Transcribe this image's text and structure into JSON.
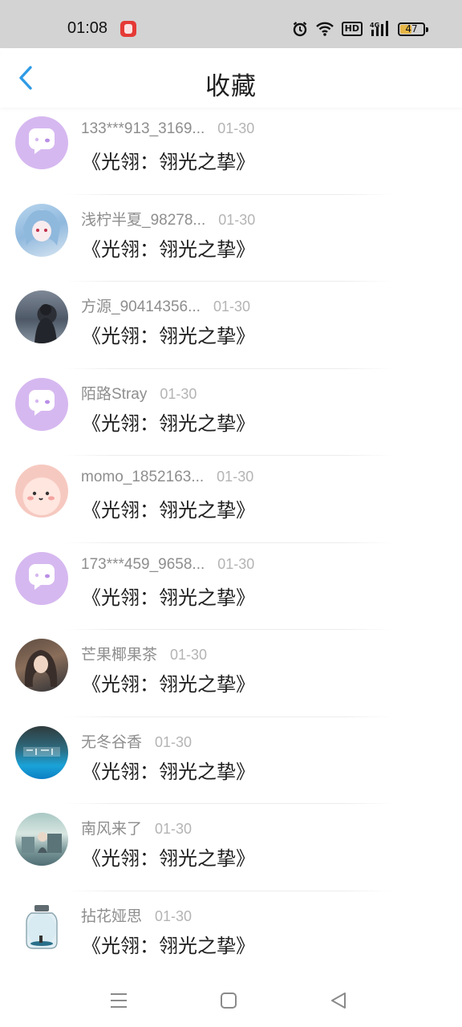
{
  "status_bar": {
    "time": "01:08",
    "battery": "47",
    "network": "4G",
    "hd": "HD",
    "icons": [
      "app-icon",
      "alarm-icon",
      "wifi-icon",
      "hd-icon",
      "signal-icon",
      "battery-icon"
    ]
  },
  "header": {
    "title": "收藏",
    "back_icon": "chevron-left-icon"
  },
  "colors": {
    "accent": "#2f9be6",
    "default_avatar": "#d6b8f0",
    "username_gray": "#8e8e8e",
    "date_gray": "#b4b4b4"
  },
  "favorites": [
    {
      "username": "133***913_3169...",
      "date": "01-30",
      "title": "《光翎：翎光之挚》",
      "avatar": "default-chat-avatar"
    },
    {
      "username": "浅柠半夏_98278...",
      "date": "01-30",
      "title": "《光翎：翎光之挚》",
      "avatar": "anime-girl-avatar"
    },
    {
      "username": "方源_90414356...",
      "date": "01-30",
      "title": "《光翎：翎光之挚》",
      "avatar": "photo-avatar"
    },
    {
      "username": "陌路Stray",
      "date": "01-30",
      "title": "《光翎：翎光之挚》",
      "avatar": "default-chat-avatar"
    },
    {
      "username": "momo_1852163...",
      "date": "01-30",
      "title": "《光翎：翎光之挚》",
      "avatar": "cute-pink-avatar"
    },
    {
      "username": "173***459_9658...",
      "date": "01-30",
      "title": "《光翎：翎光之挚》",
      "avatar": "default-chat-avatar"
    },
    {
      "username": "芒果椰果茶",
      "date": "01-30",
      "title": "《光翎：翎光之挚》",
      "avatar": "anime-girl-avatar"
    },
    {
      "username": "无冬谷香",
      "date": "01-30",
      "title": "《光翎：翎光之挚》",
      "avatar": "teal-art-avatar"
    },
    {
      "username": "南风来了",
      "date": "01-30",
      "title": "《光翎：翎光之挚》",
      "avatar": "scenery-avatar"
    },
    {
      "username": "拈花娅思",
      "date": "01-30",
      "title": "《光翎：翎光之挚》",
      "avatar": "jar-avatar"
    }
  ],
  "nav_bar": {
    "buttons": [
      "menu-icon",
      "home-icon",
      "back-triangle-icon"
    ]
  }
}
